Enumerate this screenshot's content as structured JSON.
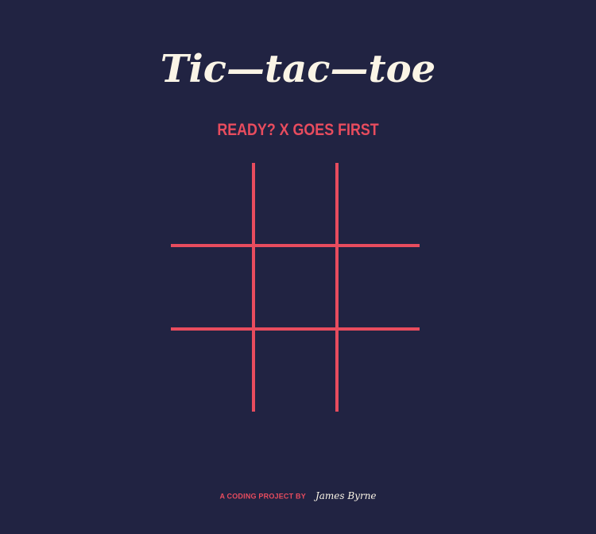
{
  "title": "Tic—tac—toe",
  "status": "READY? X GOES FIRST",
  "board": {
    "cells": [
      "",
      "",
      "",
      "",
      "",
      "",
      "",
      "",
      ""
    ]
  },
  "footer": {
    "label": "A CODING PROJECT BY",
    "author": "James Byrne"
  },
  "colors": {
    "background": "#212342",
    "accent": "#e84c5e",
    "text": "#faf4e6"
  }
}
